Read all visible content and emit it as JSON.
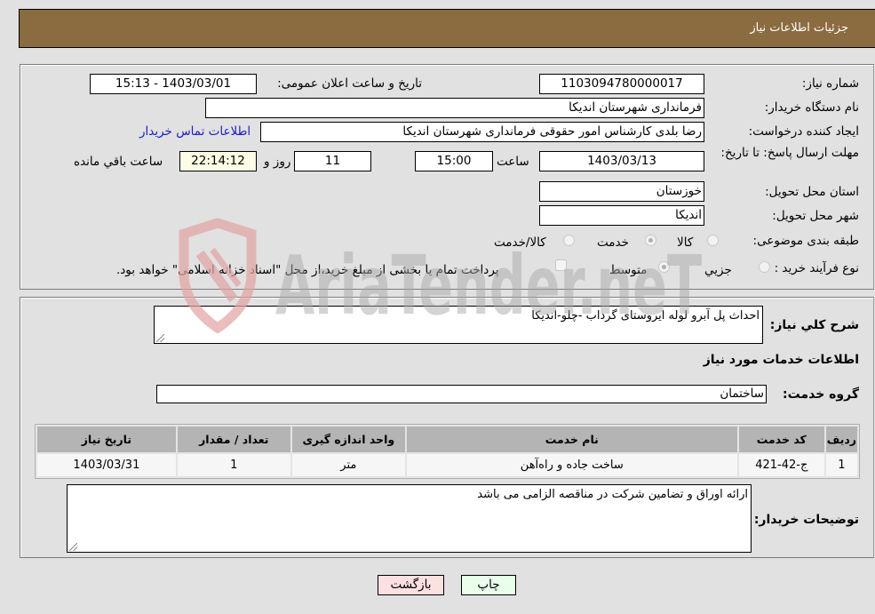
{
  "header": {
    "title": "جزئیات اطلاعات نیاز"
  },
  "details": {
    "need_number_label": "شماره نیاز:",
    "need_number": "1103094780000017",
    "announce_label": "تاریخ و ساعت اعلان عمومی:",
    "announce_value": "1403/03/01 - 15:13",
    "buyer_org_label": "نام دستگاه خریدار:",
    "buyer_org": "فرمانداری شهرستان اندیکا",
    "creator_label": "ایجاد کننده درخواست:",
    "creator": "رضا بلدی کارشناس امور حقوقی فرمانداری شهرستان اندیکا",
    "contact_link": "اطلاعات تماس خریدار",
    "deadline_label": "مهلت ارسال پاسخ: تا تاریخ:",
    "deadline_date": "1403/03/13",
    "time_label": "ساعت",
    "deadline_time": "15:00",
    "days_value": "11",
    "days_label": "روز و",
    "remaining_time": "22:14:12",
    "remaining_label": "ساعت باقي مانده",
    "province_label": "استان محل تحویل:",
    "province": "خوزستان",
    "city_label": "شهر محل تحویل:",
    "city": "اندیکا",
    "category_label": "طبقه بندی موضوعی:",
    "category_options": [
      {
        "label": "کالا",
        "selected": false
      },
      {
        "label": "خدمت",
        "selected": true
      },
      {
        "label": "کالا/خدمت",
        "selected": false
      }
    ],
    "process_label": "نوع فرآیند خرید :",
    "process_options": [
      {
        "label": "جزيي",
        "selected": false
      },
      {
        "label": "متوسط",
        "selected": true
      }
    ],
    "treasury_note": "پرداخت تمام یا بخشی از مبلغ خرید،از محل \"اسناد خزانه اسلامی\" خواهد بود."
  },
  "summary": {
    "description_label": "شرح کلي نياز:",
    "description": "احداث پل آبرو لوله ایروستای گرداب -چلو-اندیکا",
    "services_heading": "اطلاعات خدمات مورد نیاز",
    "service_group_label": "گروه خدمت:",
    "service_group": "ساختمان"
  },
  "table": {
    "columns": [
      "ردیف",
      "کد خدمت",
      "نام خدمت",
      "واحد اندازه گیری",
      "تعداد / مقدار",
      "تاریخ نیاز"
    ],
    "rows": [
      [
        "1",
        "ج-42-421",
        "ساخت جاده و راه‌آهن",
        "متر",
        "1",
        "1403/03/31"
      ]
    ]
  },
  "buyer_notes": {
    "label": "توضیحات خریدار:",
    "text": "ارائه اوراق و تضامین شرکت در مناقصه الزامی می باشد"
  },
  "buttons": {
    "print": "چاپ",
    "back": "بازگشت"
  },
  "watermark": {
    "text": "AriaTender.neT"
  },
  "colors": {
    "header_bg": "#8b6b40",
    "print_bg": "#eaffea",
    "back_bg": "#ffe0e0",
    "link": "#1a1acc"
  }
}
